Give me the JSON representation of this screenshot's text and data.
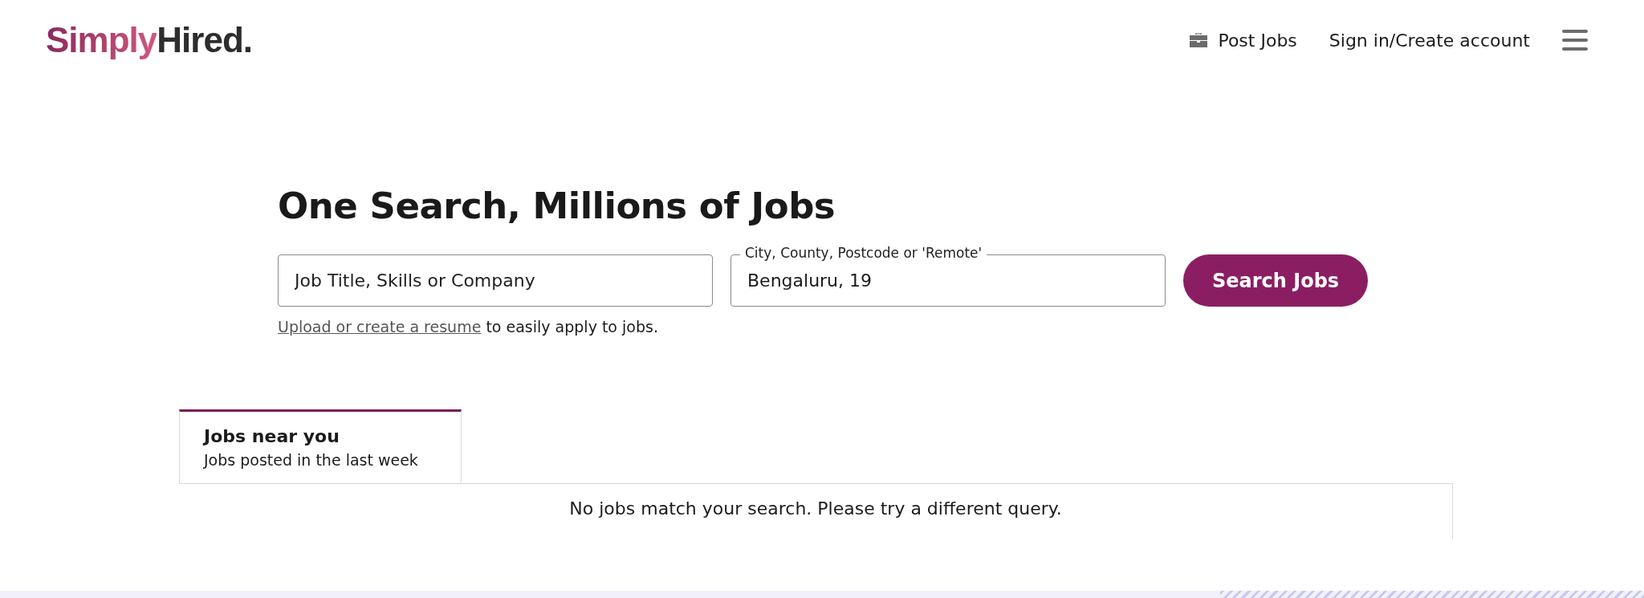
{
  "header": {
    "logo": {
      "first": "Simply",
      "second": "Hired."
    },
    "nav": [
      {
        "kind": "icon-link",
        "label": "Post Jobs"
      },
      {
        "kind": "link",
        "label": "Sign in/Create account"
      }
    ]
  },
  "search": {
    "heading": "One Search, Millions of Jobs",
    "query": {
      "placeholder": "Job Title, Skills or Company"
    },
    "location": {
      "label": "City, County, Postcode or 'Remote'",
      "value": "Bengaluru, 19"
    },
    "button": "Search Jobs",
    "resume_link": "Upload or create a resume",
    "resume_text": "to easily apply to jobs."
  },
  "tabs": [
    {
      "title": "Jobs near you",
      "subtitle": "Jobs posted in the last week",
      "selected": true
    }
  ],
  "results": {
    "message": "No jobs match your search. Please try a different query."
  }
}
